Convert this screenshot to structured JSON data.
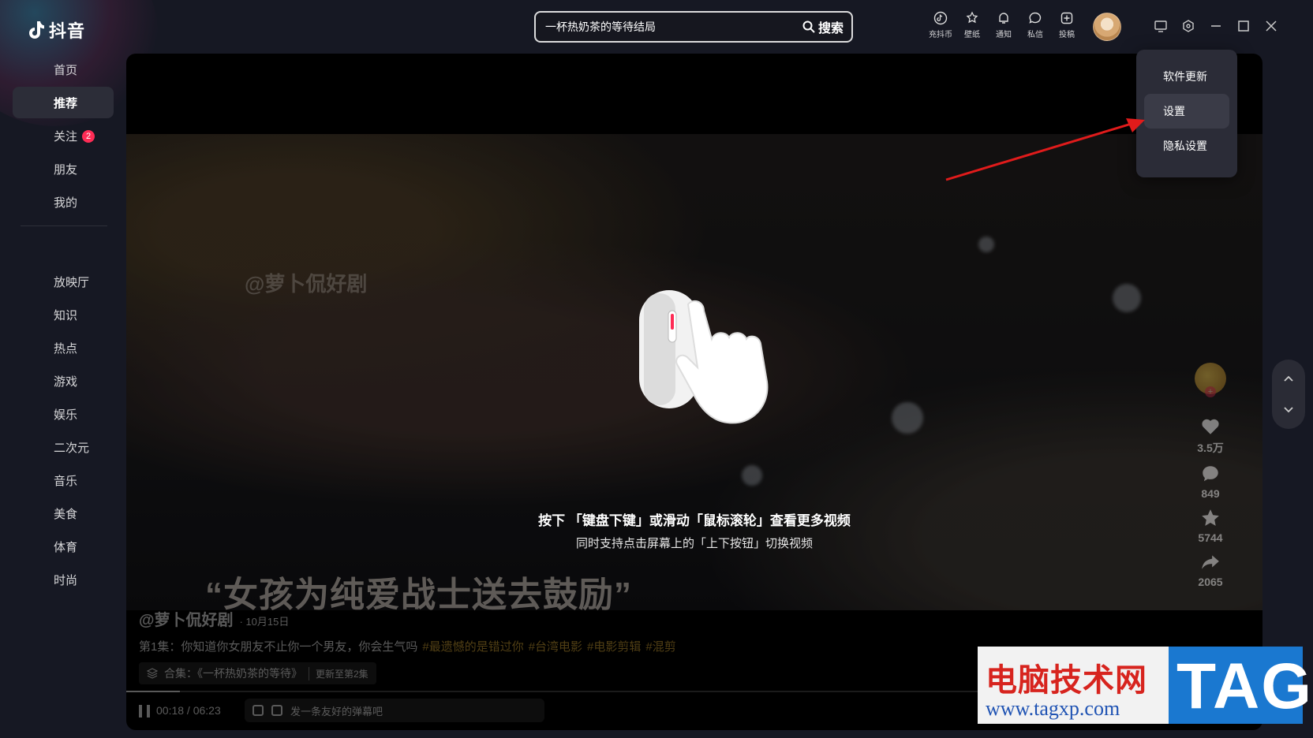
{
  "app": {
    "name": "抖音"
  },
  "sidebar": {
    "items_top": [
      {
        "label": "首页"
      },
      {
        "label": "推荐",
        "active": true
      },
      {
        "label": "关注",
        "badge": "2"
      },
      {
        "label": "朋友"
      },
      {
        "label": "我的"
      }
    ],
    "items_bottom": [
      {
        "label": "放映厅"
      },
      {
        "label": "知识"
      },
      {
        "label": "热点"
      },
      {
        "label": "游戏"
      },
      {
        "label": "娱乐"
      },
      {
        "label": "二次元"
      },
      {
        "label": "音乐"
      },
      {
        "label": "美食"
      },
      {
        "label": "体育"
      },
      {
        "label": "时尚"
      }
    ]
  },
  "search": {
    "value": "一杯热奶茶的等待结局",
    "button": "搜索"
  },
  "header_icons": [
    {
      "icon": "tiktok-coin-icon",
      "label": "充抖币"
    },
    {
      "icon": "wallpaper-icon",
      "label": "壁纸"
    },
    {
      "icon": "bell-icon",
      "label": "通知"
    },
    {
      "icon": "chat-icon",
      "label": "私信"
    },
    {
      "icon": "upload-icon",
      "label": "投稿"
    }
  ],
  "menu": {
    "items": [
      {
        "label": "软件更新"
      },
      {
        "label": "设置",
        "active": true
      },
      {
        "label": "隐私设置"
      }
    ]
  },
  "video": {
    "watermark_user": "@萝卜侃好剧",
    "subtitle": "“女孩为纯爱战士送去鼓励”",
    "guide_main": "按下 「键盘下键」或滑动「鼠标滚轮」查看更多视频",
    "guide_sub": "同时支持点击屏幕上的「上下按钮」切换视频",
    "author": "@萝卜侃好剧",
    "date": "· 10月15日",
    "description": "第1集：你知道你女朋友不止你一个男友，你会生气吗",
    "tags": [
      "#最遗憾的是错过你",
      "#台湾电影",
      "#电影剪辑",
      "#混剪"
    ],
    "collection": "合集：《一杯热奶茶的等待》",
    "collection_update": "更新至第2集",
    "likes": "3.5万",
    "comments": "849",
    "favorites": "5744",
    "shares": "2065",
    "time": "00:18 / 06:23",
    "progress": 0.047,
    "danmu_placeholder": "发一条友好的弹幕吧"
  },
  "site_watermark": {
    "cn": "电脑技术网",
    "url": "www.tagxp.com",
    "tag": "TAG"
  },
  "colors": {
    "accent": "#fe2c55",
    "background": "#161823",
    "arrow": "#e01b1b"
  }
}
